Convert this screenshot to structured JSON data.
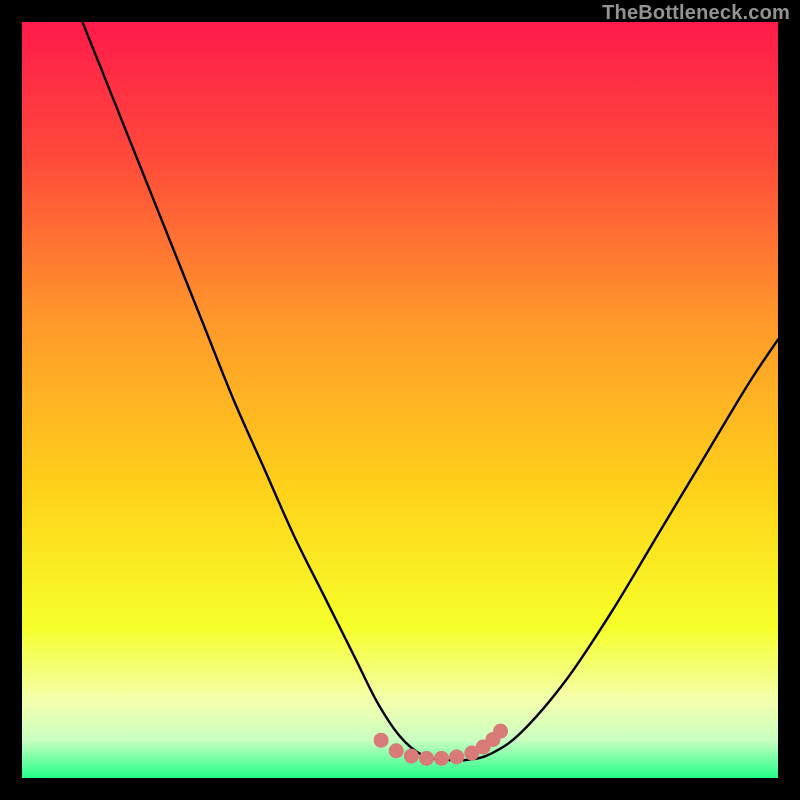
{
  "watermark": "TheBottleneck.com",
  "colors": {
    "bg": "#000000",
    "grad_top": "#ff1a4b",
    "grad_mid1": "#ff7a2e",
    "grad_mid2": "#ffd21a",
    "grad_mid3": "#f6ff2a",
    "grad_bot_yellow": "#f3ffb0",
    "grad_bot_green": "#22ff88",
    "curve": "#000000",
    "marker": "#d77a78"
  },
  "chart_data": {
    "type": "line",
    "title": "",
    "xlabel": "",
    "ylabel": "",
    "xlim": [
      0,
      100
    ],
    "ylim": [
      0,
      100
    ],
    "grid": false,
    "series": [
      {
        "name": "bottleneck-curve",
        "x": [
          8,
          12,
          16,
          20,
          24,
          28,
          32,
          36,
          40,
          44,
          47,
          50,
          53,
          56,
          59,
          62,
          66,
          72,
          78,
          84,
          90,
          96,
          100
        ],
        "y": [
          100,
          90,
          80,
          70,
          60,
          50,
          41,
          32,
          24,
          16,
          10,
          5.5,
          3,
          2.4,
          2.4,
          3.2,
          6,
          13,
          22,
          32,
          42,
          52,
          58
        ]
      }
    ],
    "markers": {
      "name": "highlight-dots",
      "x": [
        47.5,
        49.5,
        51.5,
        53.5,
        55.5,
        57.5,
        59.5,
        61.0,
        62.3,
        63.3
      ],
      "y": [
        5.0,
        3.6,
        2.9,
        2.6,
        2.6,
        2.8,
        3.3,
        4.1,
        5.1,
        6.2
      ]
    }
  }
}
